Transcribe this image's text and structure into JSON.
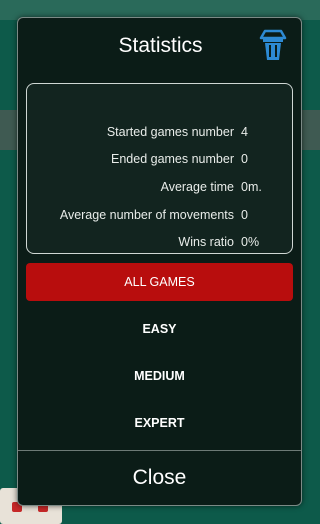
{
  "dialog": {
    "title": "Statistics",
    "stats": [
      {
        "label": "Started games number",
        "value": "4"
      },
      {
        "label": "Ended games number",
        "value": "0"
      },
      {
        "label": "Average time",
        "value": "0m."
      },
      {
        "label": "Average number of movements",
        "value": "0"
      },
      {
        "label": "Wins ratio",
        "value": "0%"
      }
    ],
    "filters": [
      "ALL GAMES",
      "EASY",
      "MEDIUM",
      "EXPERT"
    ],
    "active_filter": "ALL GAMES",
    "close_label": "Close"
  },
  "icons": {
    "delete": "trash-icon"
  },
  "colors": {
    "accent": "#b80d0d",
    "trash_icon": "#2d8ad3",
    "dialog_bg": "#0b1c17"
  }
}
